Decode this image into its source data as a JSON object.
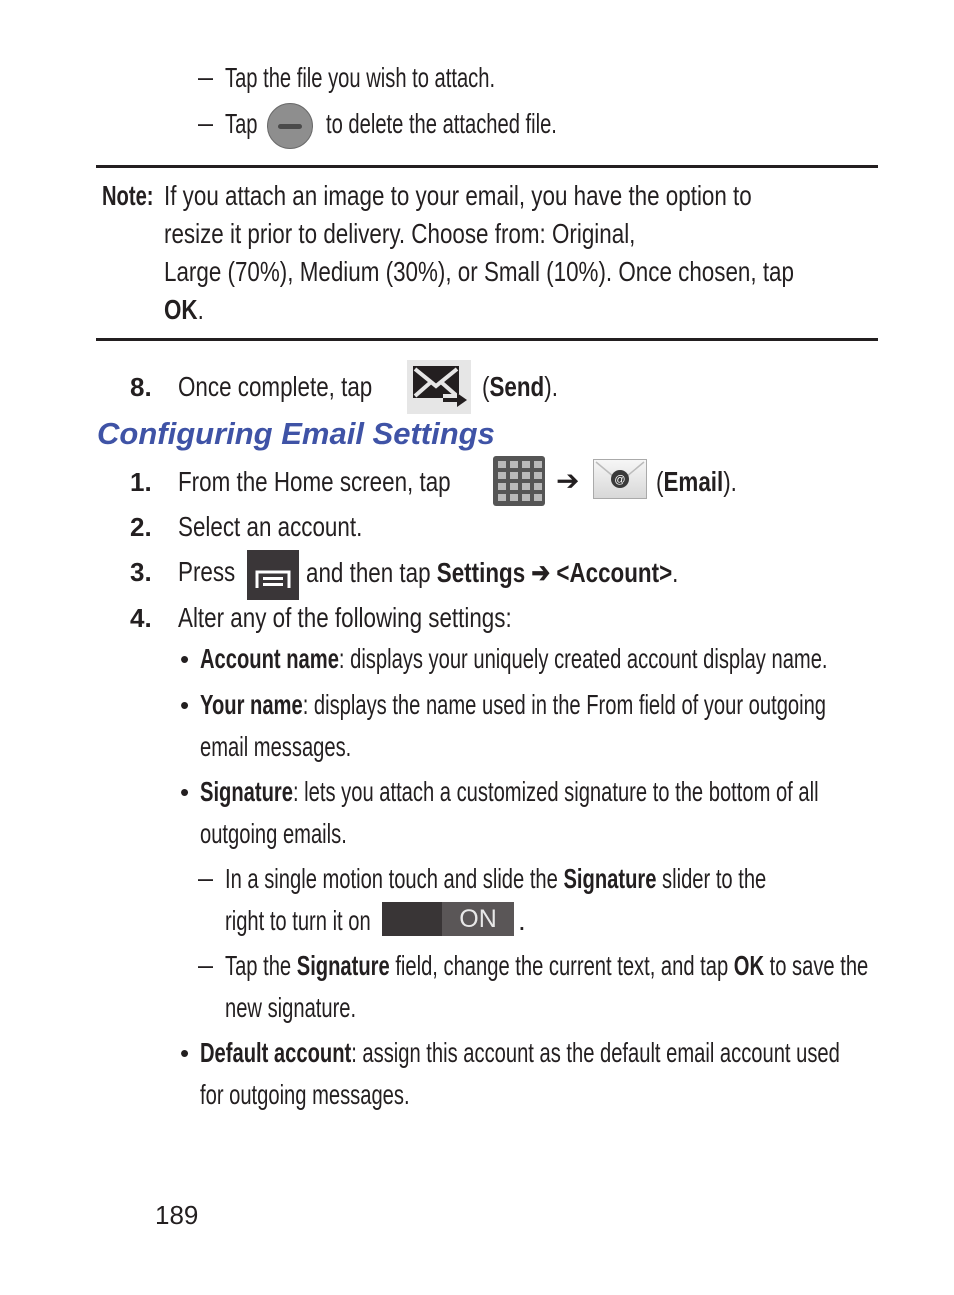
{
  "top_steps": [
    {
      "dash": "–",
      "text": "Tap the file you wish to attach."
    },
    {
      "dash": "–",
      "pre": "Tap",
      "icon": "minus-circle-icon",
      "post": "to delete the attached file."
    }
  ],
  "note": {
    "label": "Note:",
    "lines": [
      "If you attach an image to your email, you have the option to",
      "resize it prior to delivery. Choose from: Original,",
      "Large (70%), Medium (30%), or Small (10%). Once chosen, tap"
    ],
    "last_bold": "OK",
    "last_tail": "."
  },
  "step8": {
    "num": "8.",
    "pre": "Once complete, tap",
    "icon": "send-icon",
    "open": "(",
    "bold": "Send",
    "close": ")."
  },
  "section": {
    "title": "Configuring Email Settings"
  },
  "steps": [
    {
      "num": "1.",
      "pre": "From the Home screen, tap",
      "arrow": "➔",
      "open": "(",
      "bold": "Email",
      "close": ")."
    },
    {
      "num": "2.",
      "text": "Select an account."
    },
    {
      "num": "3.",
      "pre": "Press",
      "mid": "and then tap",
      "bold1": "Settings",
      "arrow": "➔",
      "bold2": "<Account>",
      "tail": "."
    },
    {
      "num": "4.",
      "text": "Alter any of the following settings:"
    }
  ],
  "settings": [
    {
      "bullet": "•",
      "bold": "Account name",
      "text": ": displays your uniquely created account display name."
    },
    {
      "bullet": "•",
      "bold": "Your name",
      "text": ": displays the name used in the From field of your outgoing",
      "cont": "email messages."
    },
    {
      "bullet": "•",
      "bold": "Signature",
      "text": ": lets you attach a customized signature to the bottom of all",
      "cont": "outgoing emails."
    },
    {
      "bullet": "•",
      "bold": "Default account",
      "text": ": assign this account as the default email account used",
      "cont": "for outgoing messages."
    }
  ],
  "signature_sub": [
    {
      "dash": "–",
      "pre": "In a single motion touch and slide the",
      "bold": "Signature",
      "post": "slider to the",
      "cont": "right to turn it on",
      "toggle_label": "ON",
      "tail": "."
    },
    {
      "dash": "–",
      "pre": "Tap the",
      "bold": "Signature",
      "mid": "field, change the current text, and tap",
      "bold2": "OK",
      "post": "to save the",
      "cont": "new signature."
    }
  ],
  "page_number": "189",
  "colors": {
    "heading": "#3f53a6",
    "text": "#231f20"
  }
}
